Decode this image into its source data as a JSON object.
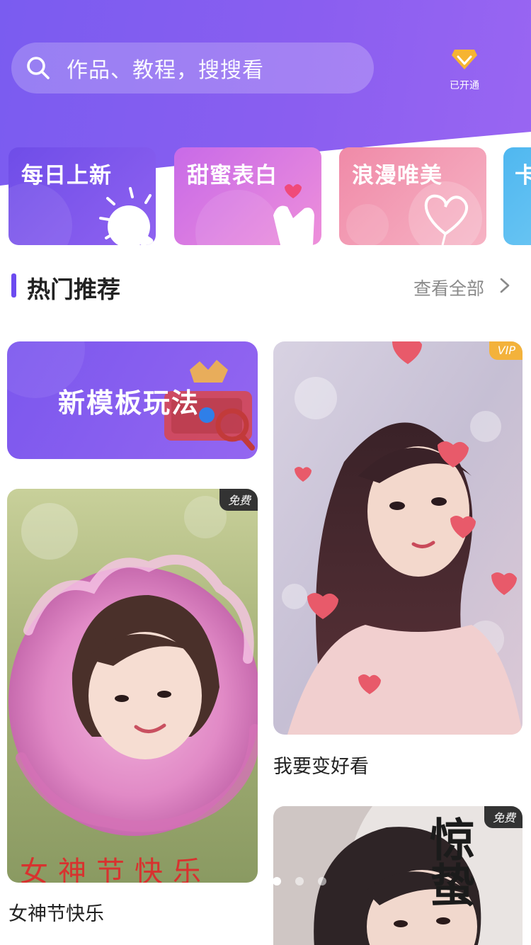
{
  "search": {
    "placeholder": "作品、教程，搜搜看"
  },
  "vip": {
    "label": "已开通",
    "icon": "diamond-icon"
  },
  "categories": [
    {
      "title": "每日上新",
      "icon": "lightbulb-icon",
      "color_from": "#6f4de8",
      "color_to": "#8f62f0"
    },
    {
      "title": "甜蜜表白",
      "icon": "finger-heart-icon",
      "color_from": "#c86ae8",
      "color_to": "#ee8fda"
    },
    {
      "title": "浪漫唯美",
      "icon": "heart-balloon-icon",
      "color_from": "#f08aa8",
      "color_to": "#f6b3c4"
    },
    {
      "title": "卡",
      "icon": "partial-card",
      "color_from": "#4fb7f0",
      "color_to": "#7dcff5"
    }
  ],
  "section": {
    "title": "热门推荐",
    "more": "查看全部"
  },
  "promo": {
    "title": "新模板玩法"
  },
  "templates": [
    {
      "caption": "我要变好看",
      "badge": "VIP",
      "badge_type": "vip"
    },
    {
      "caption": "女神节快乐",
      "badge": "免费",
      "badge_type": "free",
      "overlay_text": "女神节快乐"
    },
    {
      "caption": "",
      "badge": "免费",
      "badge_type": "free",
      "overlay_text": "惊蛰"
    }
  ],
  "pager": {
    "count": 3,
    "active": 0
  },
  "colors": {
    "accent": "#6c4bf0",
    "header": "#8a5ef0",
    "vip_badge": "#f3b23b"
  }
}
